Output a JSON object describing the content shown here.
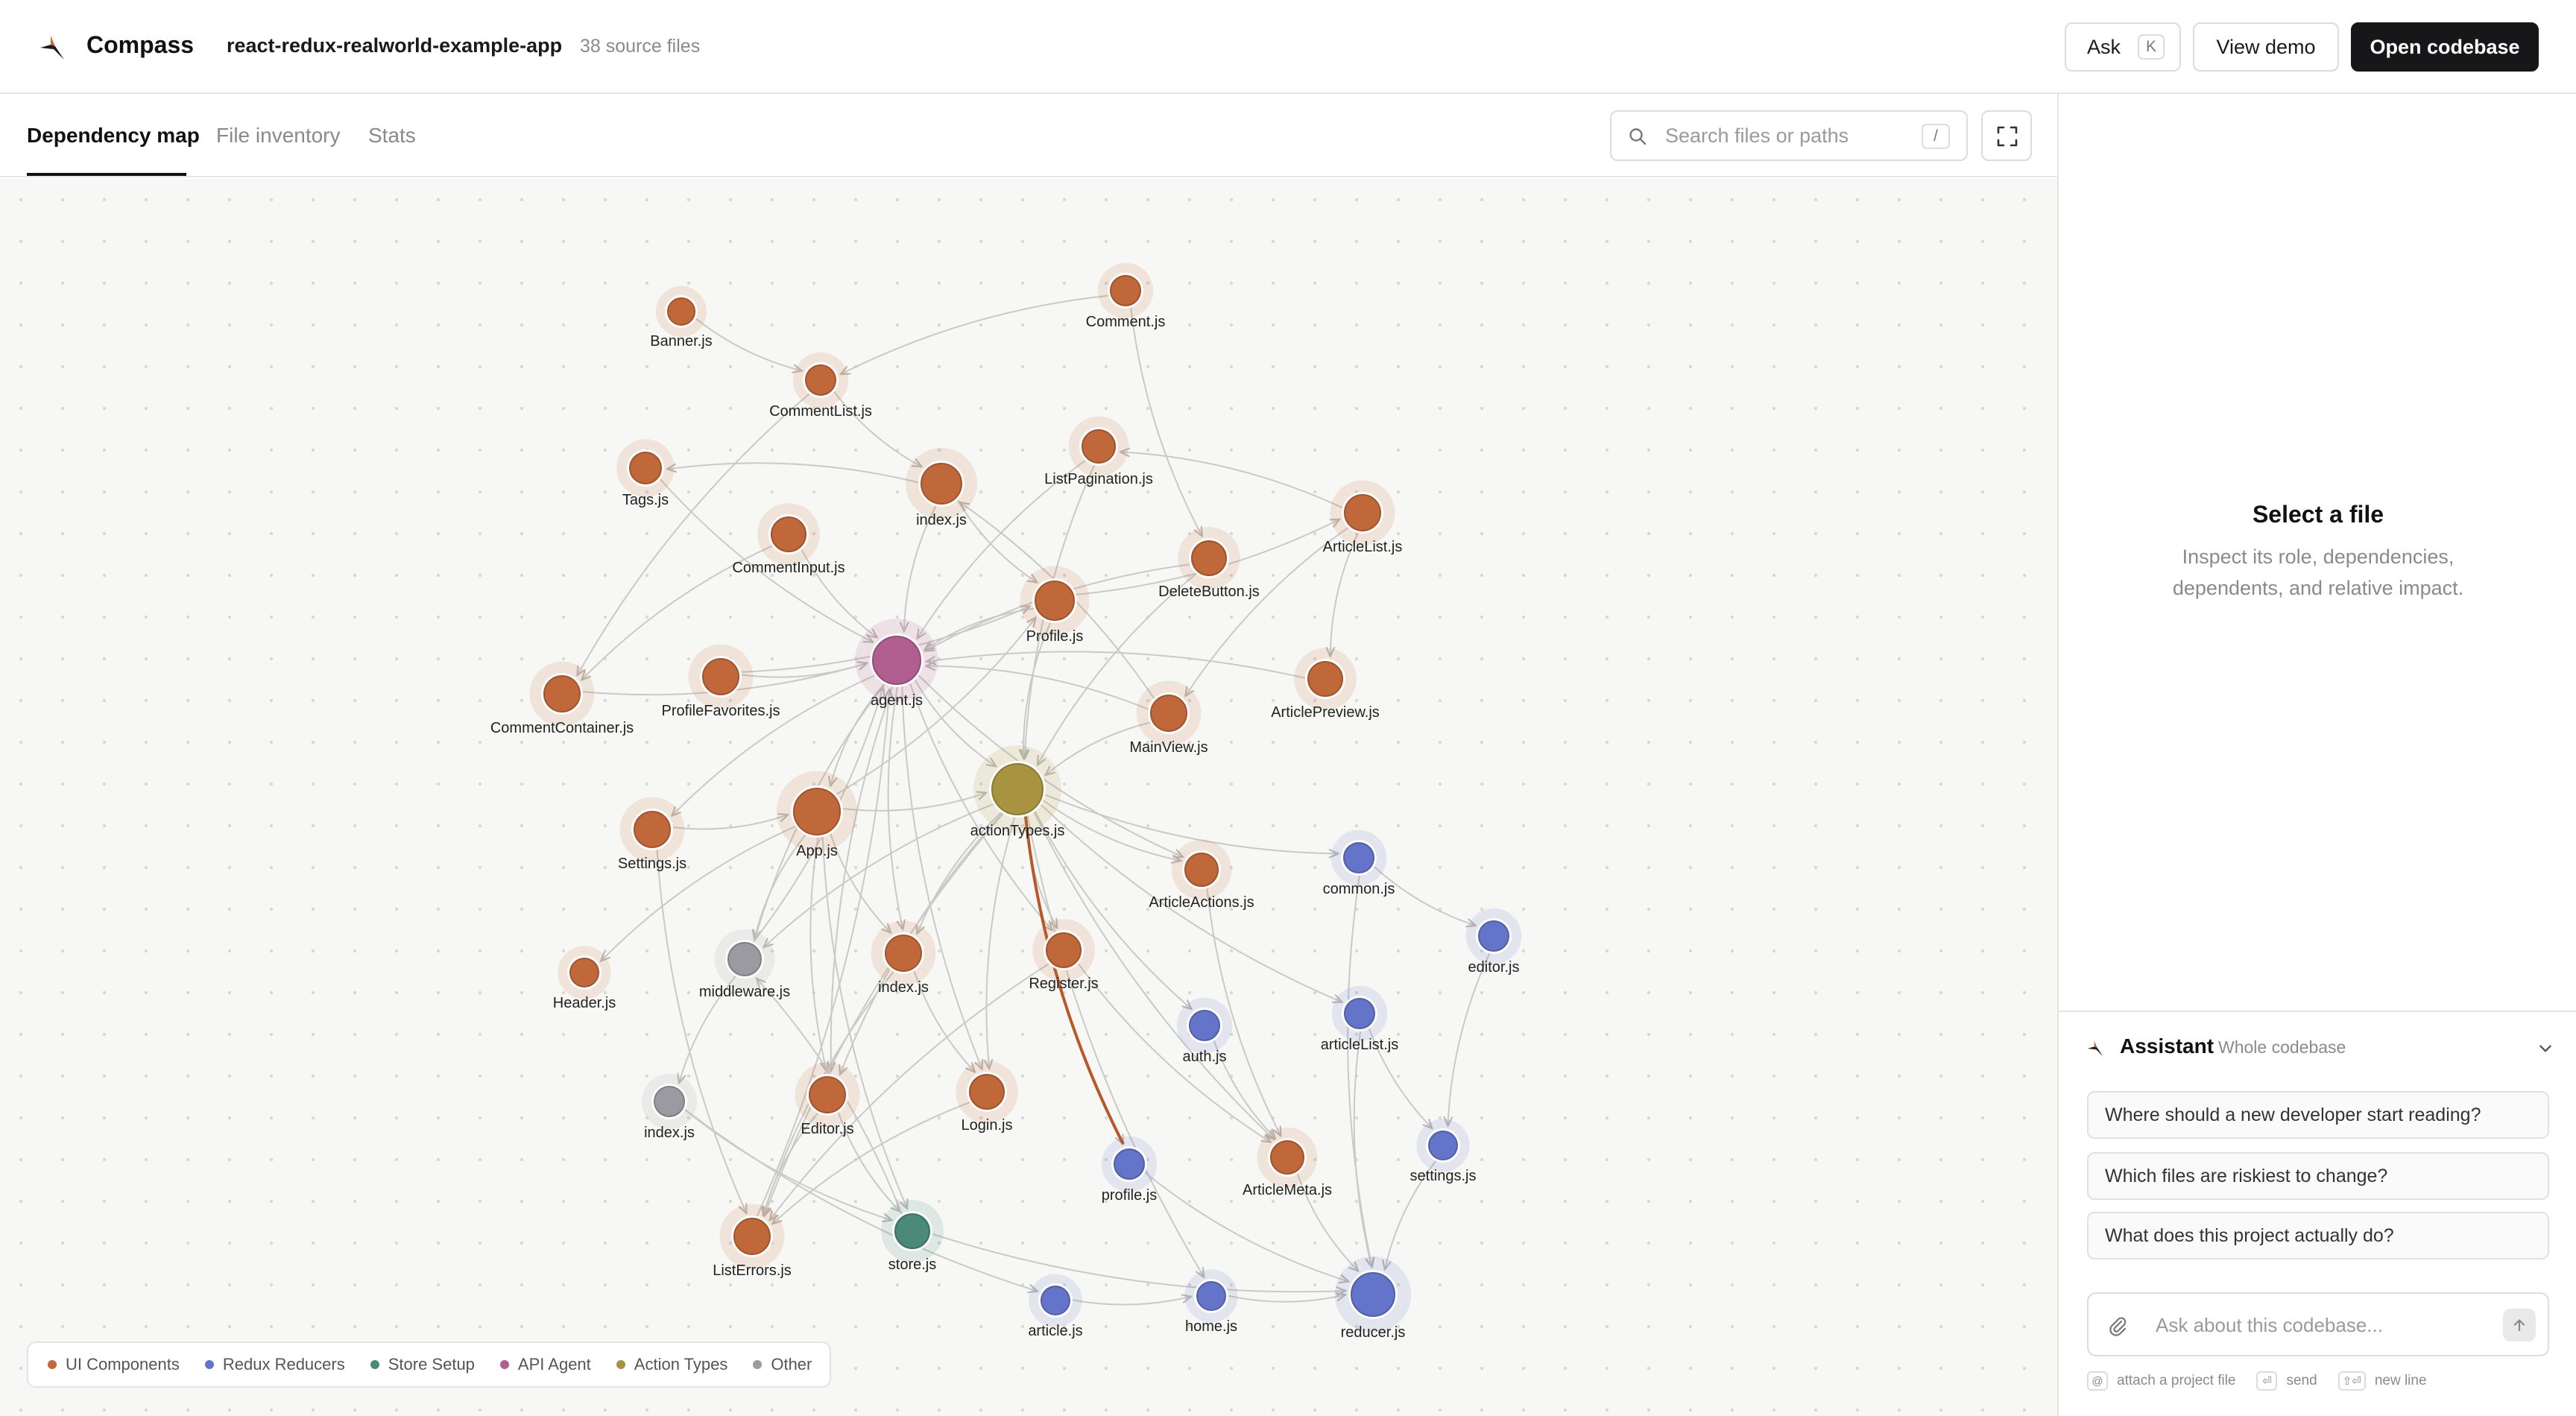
{
  "app": {
    "name": "Compass",
    "repo": "react-redux-realworld-example-app",
    "file_count": "38 source files"
  },
  "toolbar": {
    "ask_label": "Ask",
    "ask_shortcut": "K",
    "demo_label": "View demo",
    "open_label": "Open codebase"
  },
  "tabs": [
    {
      "label": "Dependency map",
      "active": true
    },
    {
      "label": "File inventory"
    },
    {
      "label": "Stats"
    }
  ],
  "search": {
    "placeholder": "Search files or paths",
    "shortcut": "/"
  },
  "colors": {
    "ui": "#c0683a",
    "reducer": "#6474c8",
    "store": "#4a8a76",
    "agent": "#b05f90",
    "action": "#a89440",
    "other": "#9a9aa0",
    "edge": "#c9c9c6",
    "highlight": "#b8582a"
  },
  "legend": [
    {
      "label": "UI Components",
      "color": "#c0683a"
    },
    {
      "label": "Redux Reducers",
      "color": "#6474c8"
    },
    {
      "label": "Store Setup",
      "color": "#4a8a76"
    },
    {
      "label": "API Agent",
      "color": "#b05f90"
    },
    {
      "label": "Action Types",
      "color": "#a89440"
    },
    {
      "label": "Other",
      "color": "#9a9aa0"
    }
  ],
  "graph": {
    "nodes": [
      {
        "id": "banner",
        "label": "Banner.js",
        "group": "ui"
      },
      {
        "id": "comment",
        "label": "Comment.js",
        "group": "ui"
      },
      {
        "id": "commentlist",
        "label": "CommentList.js",
        "group": "ui"
      },
      {
        "id": "tags",
        "label": "Tags.js",
        "group": "ui"
      },
      {
        "id": "index1",
        "label": "index.js",
        "group": "ui"
      },
      {
        "id": "listpag",
        "label": "ListPagination.js",
        "group": "ui"
      },
      {
        "id": "commentinput",
        "label": "CommentInput.js",
        "group": "ui"
      },
      {
        "id": "articlelist",
        "label": "ArticleList.js",
        "group": "ui"
      },
      {
        "id": "deletebtn",
        "label": "DeleteButton.js",
        "group": "ui"
      },
      {
        "id": "profile",
        "label": "Profile.js",
        "group": "ui"
      },
      {
        "id": "commentcont",
        "label": "CommentContainer.js",
        "group": "ui"
      },
      {
        "id": "proffav",
        "label": "ProfileFavorites.js",
        "group": "ui"
      },
      {
        "id": "agent",
        "label": "agent.js",
        "group": "agent"
      },
      {
        "id": "articleprev",
        "label": "ArticlePreview.js",
        "group": "ui"
      },
      {
        "id": "mainview",
        "label": "MainView.js",
        "group": "ui"
      },
      {
        "id": "actiontypes",
        "label": "actionTypes.js",
        "group": "action"
      },
      {
        "id": "settingsui",
        "label": "Settings.js",
        "group": "ui"
      },
      {
        "id": "app",
        "label": "App.js",
        "group": "ui"
      },
      {
        "id": "articleactions",
        "label": "ArticleActions.js",
        "group": "ui"
      },
      {
        "id": "common",
        "label": "common.js",
        "group": "reducer"
      },
      {
        "id": "editorred",
        "label": "editor.js",
        "group": "reducer"
      },
      {
        "id": "header",
        "label": "Header.js",
        "group": "ui"
      },
      {
        "id": "middleware",
        "label": "middleware.js",
        "group": "other"
      },
      {
        "id": "index2",
        "label": "index.js",
        "group": "ui"
      },
      {
        "id": "register",
        "label": "Register.js",
        "group": "ui"
      },
      {
        "id": "auth",
        "label": "auth.js",
        "group": "reducer"
      },
      {
        "id": "articlelistred",
        "label": "articleList.js",
        "group": "reducer"
      },
      {
        "id": "index3",
        "label": "index.js",
        "group": "other"
      },
      {
        "id": "editor",
        "label": "Editor.js",
        "group": "ui"
      },
      {
        "id": "login",
        "label": "Login.js",
        "group": "ui"
      },
      {
        "id": "settingsred",
        "label": "settings.js",
        "group": "reducer"
      },
      {
        "id": "profilered",
        "label": "profile.js",
        "group": "reducer"
      },
      {
        "id": "articlemeta",
        "label": "ArticleMeta.js",
        "group": "ui"
      },
      {
        "id": "listerrors",
        "label": "ListErrors.js",
        "group": "ui"
      },
      {
        "id": "store",
        "label": "store.js",
        "group": "store"
      },
      {
        "id": "article",
        "label": "article.js",
        "group": "reducer"
      },
      {
        "id": "home",
        "label": "home.js",
        "group": "reducer"
      },
      {
        "id": "reducer",
        "label": "reducer.js",
        "group": "reducer"
      }
    ],
    "edges": [
      [
        "banner",
        "commentlist"
      ],
      [
        "comment",
        "commentlist"
      ],
      [
        "comment",
        "deletebtn"
      ],
      [
        "commentlist",
        "index1"
      ],
      [
        "commentlist",
        "commentcont"
      ],
      [
        "index1",
        "tags"
      ],
      [
        "index1",
        "agent"
      ],
      [
        "index1",
        "profile"
      ],
      [
        "tags",
        "agent"
      ],
      [
        "commentinput",
        "agent"
      ],
      [
        "commentinput",
        "commentcont"
      ],
      [
        "listpag",
        "agent"
      ],
      [
        "listpag",
        "actiontypes"
      ],
      [
        "articlelist",
        "listpag"
      ],
      [
        "articlelist",
        "articleprev"
      ],
      [
        "articlelist",
        "mainview"
      ],
      [
        "deletebtn",
        "agent"
      ],
      [
        "deletebtn",
        "actiontypes"
      ],
      [
        "profile",
        "agent"
      ],
      [
        "profile",
        "actiontypes"
      ],
      [
        "profile",
        "articlelist"
      ],
      [
        "proffav",
        "agent"
      ],
      [
        "proffav",
        "profile"
      ],
      [
        "commentcont",
        "agent"
      ],
      [
        "articleprev",
        "agent"
      ],
      [
        "mainview",
        "agent"
      ],
      [
        "mainview",
        "actiontypes"
      ],
      [
        "mainview",
        "index1"
      ],
      [
        "agent",
        "app"
      ],
      [
        "agent",
        "actiontypes"
      ],
      [
        "agent",
        "editor"
      ],
      [
        "agent",
        "login"
      ],
      [
        "agent",
        "register"
      ],
      [
        "agent",
        "index2"
      ],
      [
        "agent",
        "settingsui"
      ],
      [
        "agent",
        "middleware"
      ],
      [
        "agent",
        "articleactions"
      ],
      [
        "settingsui",
        "app"
      ],
      [
        "settingsui",
        "listerrors"
      ],
      [
        "app",
        "actiontypes"
      ],
      [
        "app",
        "header"
      ],
      [
        "app",
        "middleware"
      ],
      [
        "app",
        "index2"
      ],
      [
        "app",
        "editor"
      ],
      [
        "app",
        "store"
      ],
      [
        "app",
        "profile"
      ],
      [
        "actiontypes",
        "articleactions"
      ],
      [
        "actiontypes",
        "common"
      ],
      [
        "actiontypes",
        "register"
      ],
      [
        "actiontypes",
        "index2"
      ],
      [
        "actiontypes",
        "login"
      ],
      [
        "actiontypes",
        "editor"
      ],
      [
        "actiontypes",
        "auth"
      ],
      [
        "actiontypes",
        "articlelistred"
      ],
      [
        "actiontypes",
        "profilered"
      ],
      [
        "actiontypes",
        "home"
      ],
      [
        "actiontypes",
        "articlemeta"
      ],
      [
        "actiontypes",
        "middleware"
      ],
      [
        "actiontypes",
        "listerrors"
      ],
      [
        "articleactions",
        "articlemeta"
      ],
      [
        "common",
        "editorred"
      ],
      [
        "common",
        "reducer"
      ],
      [
        "editorred",
        "settingsred"
      ],
      [
        "middleware",
        "index3"
      ],
      [
        "middleware",
        "agent"
      ],
      [
        "index2",
        "login"
      ],
      [
        "index2",
        "listerrors"
      ],
      [
        "register",
        "listerrors"
      ],
      [
        "register",
        "articlemeta"
      ],
      [
        "auth",
        "articlemeta"
      ],
      [
        "articlelistred",
        "reducer"
      ],
      [
        "articlelistred",
        "settingsred"
      ],
      [
        "index3",
        "store"
      ],
      [
        "index3",
        "article"
      ],
      [
        "editor",
        "listerrors"
      ],
      [
        "editor",
        "store"
      ],
      [
        "login",
        "listerrors"
      ],
      [
        "settingsred",
        "reducer"
      ],
      [
        "profilered",
        "reducer"
      ],
      [
        "articlemeta",
        "reducer"
      ],
      [
        "store",
        "reducer"
      ],
      [
        "store",
        "middleware"
      ],
      [
        "article",
        "home"
      ],
      [
        "home",
        "reducer"
      ],
      [
        "listerrors",
        "agent"
      ]
    ],
    "highlight_edge": [
      "actiontypes",
      "profilered"
    ]
  },
  "details": {
    "title": "Select a file",
    "description": "Inspect its role, dependencies, dependents, and relative impact."
  },
  "assistant": {
    "title": "Assistant",
    "scope": "Whole codebase",
    "suggestions": [
      "Where should a new developer start reading?",
      "Which files are riskiest to change?",
      "What does this project actually do?"
    ],
    "input_placeholder": "Ask about this codebase...",
    "hints": [
      {
        "key": "@",
        "label": "attach a project file"
      },
      {
        "key": "⏎",
        "label": "send"
      },
      {
        "key": "⇧⏎",
        "label": "new line"
      }
    ]
  }
}
